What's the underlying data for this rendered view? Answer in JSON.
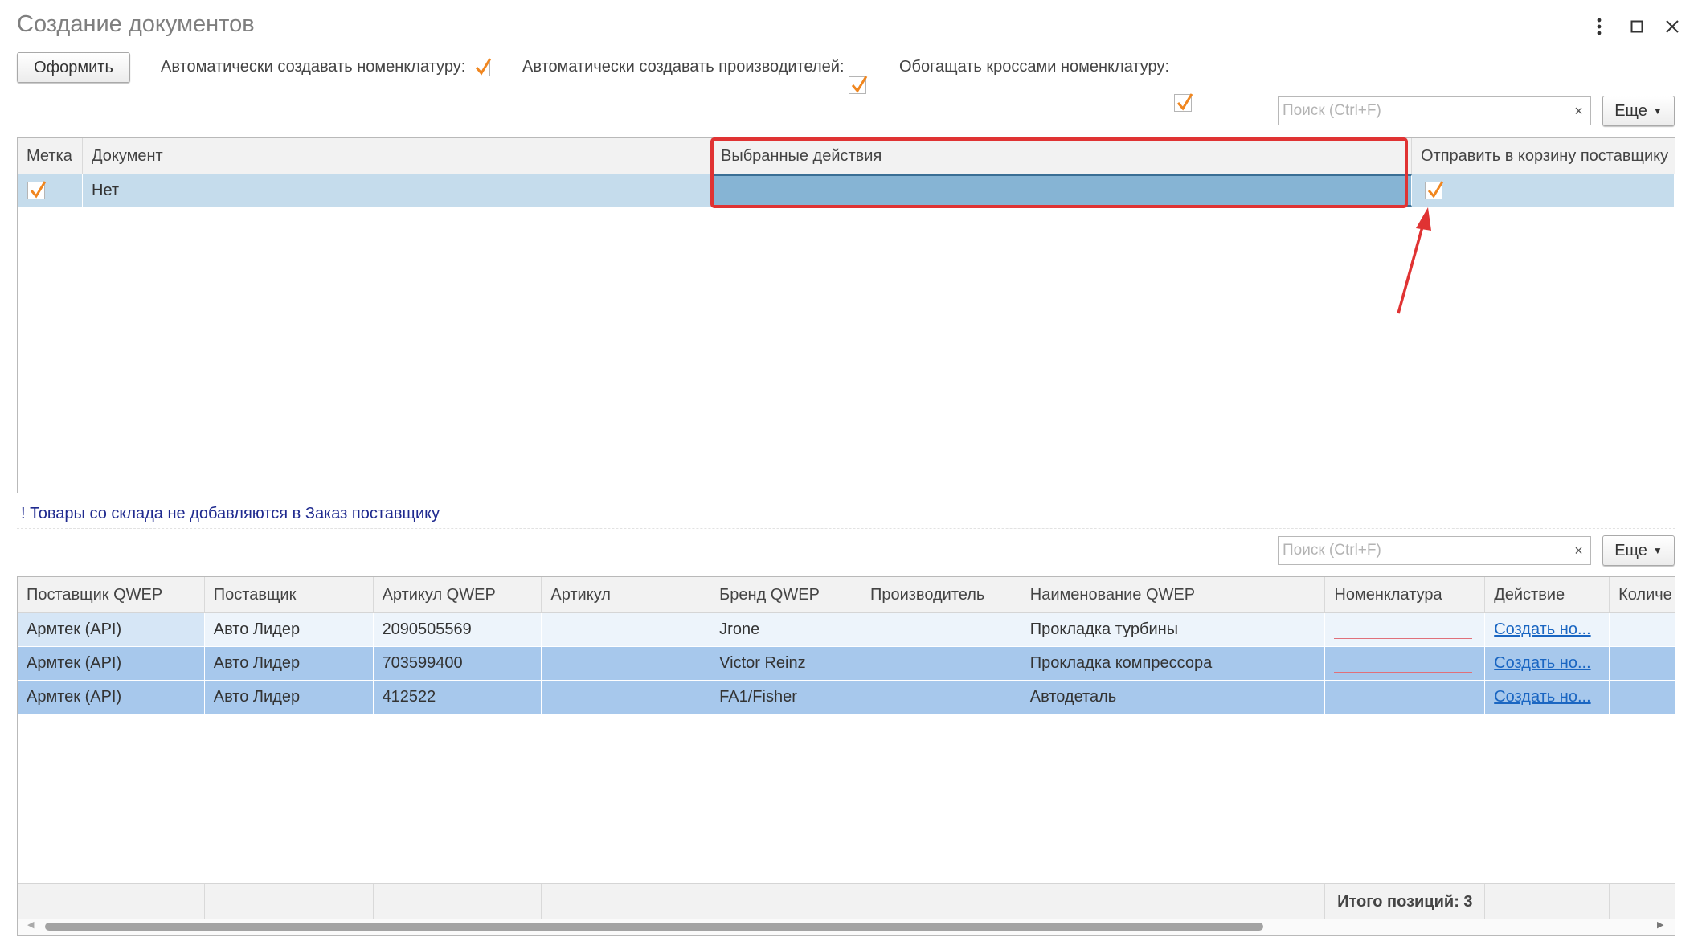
{
  "window": {
    "title": "Создание документов"
  },
  "toolbar": {
    "process_label": "Оформить",
    "auto_nomenclature_label": "Автоматически создавать номенклатуру:",
    "auto_nomenclature_checked": true,
    "auto_manufacturers_label": "Автоматически создавать производителей:",
    "auto_manufacturers_checked": true,
    "enrich_crosses_label": "Обогащать кроссами номенклатуру:",
    "enrich_crosses_checked": true
  },
  "search_top": {
    "placeholder": "Поиск (Ctrl+F)",
    "clear": "×",
    "more_label": "Еще"
  },
  "documents_table": {
    "columns": [
      "Метка",
      "Документ",
      "Выбранные действия",
      "Отправить в корзину поставщику"
    ],
    "rows": [
      {
        "mark": true,
        "document": "Нет",
        "actions": "",
        "send_to_cart": true
      }
    ]
  },
  "warning": "! Товары со склада не добавляются в Заказ поставщику",
  "search_bottom": {
    "placeholder": "Поиск (Ctrl+F)",
    "clear": "×",
    "more_label": "Еще"
  },
  "items_table": {
    "columns": [
      "Поставщик QWEP",
      "Поставщик",
      "Артикул QWEP",
      "Артикул",
      "Бренд QWEP",
      "Производитель",
      "Наименование QWEP",
      "Номенклатура",
      "Действие",
      "Количе"
    ],
    "rows": [
      {
        "supplier_qwep": "Армтек (API)",
        "supplier": "Авто Лидер",
        "article_qwep": "2090505569",
        "article": "",
        "brand_qwep": "Jrone",
        "manufacturer": "",
        "name_qwep": "Прокладка турбины",
        "nomenclature": "",
        "action": "Создать но..."
      },
      {
        "supplier_qwep": "Армтек (API)",
        "supplier": "Авто Лидер",
        "article_qwep": "703599400",
        "article": "",
        "brand_qwep": "Victor Reinz",
        "manufacturer": "",
        "name_qwep": "Прокладка компрессора",
        "nomenclature": "",
        "action": "Создать но..."
      },
      {
        "supplier_qwep": "Армтек (API)",
        "supplier": "Авто Лидер",
        "article_qwep": "412522",
        "article": "",
        "brand_qwep": "FA1/Fisher",
        "manufacturer": "",
        "name_qwep": "Автодеталь",
        "nomenclature": "",
        "action": "Создать но..."
      }
    ],
    "footer_total": "Итого позиций: 3"
  },
  "colors": {
    "selected_row": "#c5dcec",
    "selected_cell": "#86b4d4",
    "row_selected_blue": "#a7c8ec",
    "row_light": "#edf4fb",
    "annotation_red": "#e03333",
    "check_orange": "#f0861f"
  }
}
